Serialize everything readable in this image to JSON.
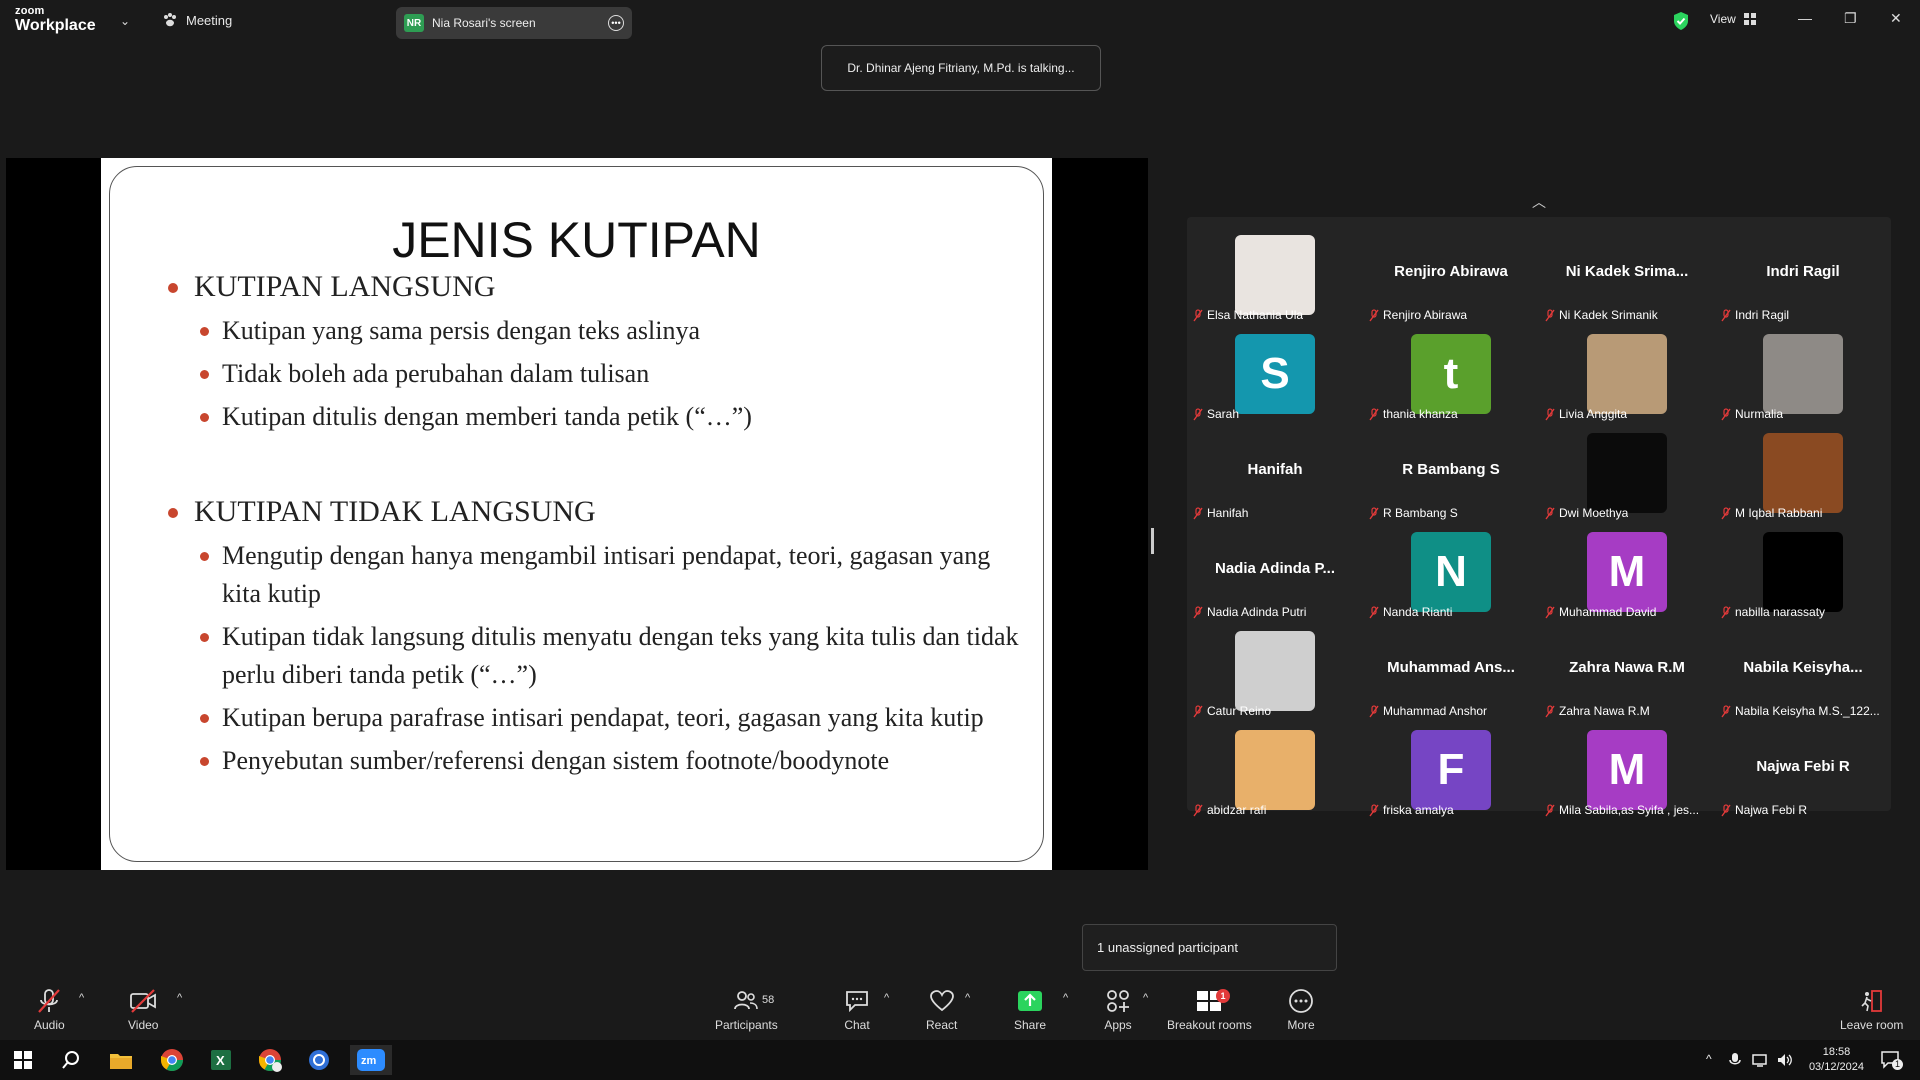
{
  "app": {
    "brand_small": "zoom",
    "brand_big": "Workplace"
  },
  "topbar": {
    "meeting_label": "Meeting",
    "screen_badge": "NR",
    "screen_label": "Nia Rosari's screen",
    "view_label": "View"
  },
  "talking_banner": "Dr. Dhinar Ajeng Fitriany, M.Pd. is talking...",
  "slide": {
    "title": "JENIS KUTIPAN",
    "sections": [
      {
        "heading": "KUTIPAN LANGSUNG",
        "bullets": [
          "Kutipan yang sama persis dengan teks aslinya",
          "Tidak boleh ada perubahan dalam tulisan",
          "Kutipan ditulis dengan memberi tanda petik (“…”)"
        ]
      },
      {
        "heading": "KUTIPAN TIDAK LANGSUNG",
        "bullets": [
          "Mengutip dengan hanya mengambil intisari pendapat, teori, gagasan yang kita kutip",
          "Kutipan tidak langsung ditulis menyatu dengan teks yang kita tulis dan tidak perlu diberi tanda petik (“…”)",
          "Kutipan berupa parafrase intisari pendapat, teori, gagasan yang kita kutip",
          "Penyebutan sumber/referensi dengan sistem footnote/boodynote"
        ]
      }
    ]
  },
  "participants_tiles": [
    {
      "label": "Elsa Nathania Ula",
      "kind": "photo",
      "color": "#e9e4e0"
    },
    {
      "label": "Renjiro Abirawa",
      "kind": "name",
      "big": "Renjiro Abirawa"
    },
    {
      "label": "Ni Kadek Srimanik",
      "kind": "name",
      "big": "Ni  Kadek  Srima..."
    },
    {
      "label": "Indri Ragil",
      "kind": "name",
      "big": "Indri Ragil"
    },
    {
      "label": "Sarah",
      "kind": "letter",
      "letter": "S",
      "color": "#1497ae"
    },
    {
      "label": "thania khanza",
      "kind": "letter",
      "letter": "t",
      "color": "#5aa02c"
    },
    {
      "label": "Livia Anggita",
      "kind": "photo",
      "color": "#b89a76"
    },
    {
      "label": "Nurmalia",
      "kind": "photo",
      "color": "#8e8a86"
    },
    {
      "label": "Hanifah",
      "kind": "name",
      "big": "Hanifah"
    },
    {
      "label": "R Bambang S",
      "kind": "name",
      "big": "R Bambang S"
    },
    {
      "label": "Dwi Moethya",
      "kind": "photo",
      "color": "#0b0b0b"
    },
    {
      "label": "M Iqbal Rabbani",
      "kind": "photo",
      "color": "#8a4a22"
    },
    {
      "label": "Nadia Adinda Putri",
      "kind": "name",
      "big": "Nadia  Adinda  P..."
    },
    {
      "label": "Nanda Rianti",
      "kind": "letter",
      "letter": "N",
      "color": "#0f8f86"
    },
    {
      "label": "Muhammad David",
      "kind": "letter",
      "letter": "M",
      "color": "#a63cc4"
    },
    {
      "label": "nabilla narassaty",
      "kind": "photo",
      "color": "#000000"
    },
    {
      "label": "Catur Reino",
      "kind": "photo",
      "color": "#cfcfcf"
    },
    {
      "label": "Muhammad Anshor",
      "kind": "name",
      "big": "Muhammad  Ans..."
    },
    {
      "label": "Zahra Nawa R.M",
      "kind": "name",
      "big": "Zahra Nawa R.M"
    },
    {
      "label": "Nabila Keisyha M.S._122...",
      "kind": "name",
      "big": "Nabila  Keisyha..."
    },
    {
      "label": "abidzar rafi",
      "kind": "photo",
      "color": "#e8b06a"
    },
    {
      "label": "friska amalya",
      "kind": "letter",
      "letter": "F",
      "color": "#7645c4"
    },
    {
      "label": "Mila Sabila,as Syifa , jes...",
      "kind": "letter",
      "letter": "M",
      "color": "#a63cc4"
    },
    {
      "label": "Najwa Febi R",
      "kind": "name",
      "big": "Najwa Febi R"
    }
  ],
  "tooltip": "1 unassigned participant",
  "toolbar": {
    "audio": "Audio",
    "video": "Video",
    "participants": "Participants",
    "participants_count": "58",
    "chat": "Chat",
    "react": "React",
    "share": "Share",
    "apps": "Apps",
    "breakout": "Breakout rooms",
    "breakout_badge": "1",
    "more": "More",
    "leave": "Leave room"
  },
  "taskbar": {
    "time": "18:58",
    "date": "03/12/2024",
    "notif": "1"
  },
  "colors": {
    "accent_green": "#2bd45e",
    "bullet": "#c8462e",
    "danger": "#e23a3a"
  }
}
